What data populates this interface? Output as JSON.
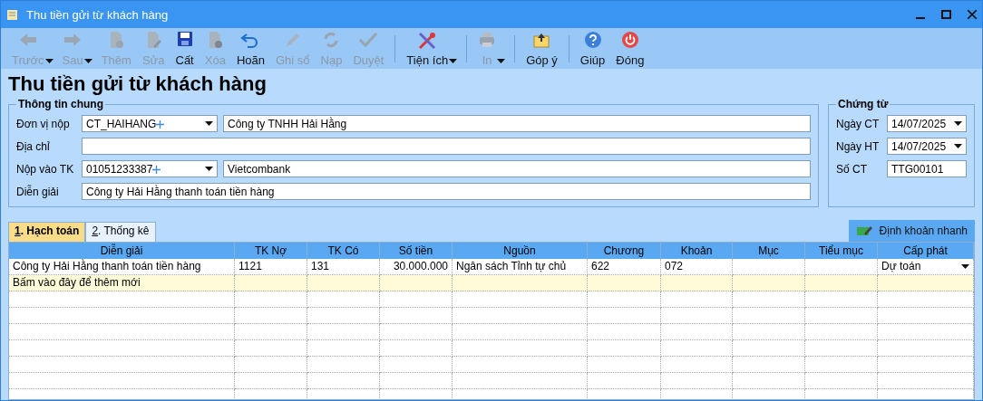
{
  "window": {
    "title": "Thu tiền gửi từ khách hàng"
  },
  "toolbar": [
    {
      "kind": "button",
      "label": "Trước",
      "disabled": true,
      "dropdown": true
    },
    {
      "kind": "button",
      "label": "Sau",
      "disabled": true,
      "dropdown": true
    },
    {
      "kind": "button",
      "label": "Thêm",
      "disabled": true,
      "dropdown": false
    },
    {
      "kind": "button",
      "label": "Sửa",
      "disabled": true,
      "dropdown": false
    },
    {
      "kind": "button",
      "label": "Cất",
      "disabled": false,
      "dropdown": false
    },
    {
      "kind": "button",
      "label": "Xóa",
      "disabled": true,
      "dropdown": false
    },
    {
      "kind": "button",
      "label": "Hoãn",
      "disabled": false,
      "dropdown": false
    },
    {
      "kind": "button",
      "label": "Ghi sổ",
      "disabled": true,
      "dropdown": false
    },
    {
      "kind": "button",
      "label": "Nạp",
      "disabled": true,
      "dropdown": false
    },
    {
      "kind": "button",
      "label": "Duyệt",
      "disabled": true,
      "dropdown": false
    },
    {
      "kind": "separator"
    },
    {
      "kind": "button",
      "label": "Tiện ích",
      "disabled": false,
      "dropdown": true
    },
    {
      "kind": "separator"
    },
    {
      "kind": "button",
      "label": "In",
      "disabled": true,
      "dropdown": true
    },
    {
      "kind": "separator"
    },
    {
      "kind": "button",
      "label": "Góp ý",
      "disabled": false,
      "dropdown": false
    },
    {
      "kind": "separator"
    },
    {
      "kind": "button",
      "label": "Giúp",
      "disabled": false,
      "dropdown": false
    },
    {
      "kind": "button",
      "label": "Đóng",
      "disabled": false,
      "dropdown": false
    }
  ],
  "heading": "Thu tiền gửi từ khách hàng",
  "general": {
    "title": "Thông tin chung",
    "fields": [
      {
        "kind": "lookup",
        "label": "Đơn vị nộp",
        "code": "CT_HAIHANG",
        "value": "Công ty TNHH Hải Hằng"
      },
      {
        "kind": "text",
        "label": "Địa chỉ"
      },
      {
        "kind": "lookup",
        "label": "Nộp vào TK",
        "code": "01051233387",
        "value": "Vietcombank"
      },
      {
        "kind": "text",
        "label": "Diễn giải",
        "value": "Công ty Hải Hằng thanh toán tiền hàng"
      }
    ]
  },
  "voucher": {
    "title": "Chứng từ",
    "fields": [
      {
        "kind": "date",
        "label": "Ngày CT",
        "value": "14/07/2025"
      },
      {
        "kind": "date",
        "label": "Ngày HT",
        "value": "14/07/2025"
      },
      {
        "kind": "text",
        "label": "Số CT",
        "value": "TTG00101"
      }
    ]
  },
  "tabs": [
    {
      "key": "1",
      "label": ". Hạch toán",
      "selected": true
    },
    {
      "key": "2",
      "label": ". Thống kê",
      "selected": false
    }
  ],
  "quick_button": "Định khoản nhanh",
  "table": {
    "columns": [
      "Diễn giải",
      "TK Nợ",
      "TK Có",
      "Số tiền",
      "Nguồn",
      "Chương",
      "Khoản",
      "Mục",
      "Tiểu mục",
      "Cấp phát"
    ],
    "rows": [
      [
        "Công ty Hải Hằng thanh toán tiền hàng",
        "1121",
        "131",
        "30.000.000",
        "Ngân sách Tỉnh tự chủ",
        "622",
        "072",
        "",
        "",
        "Dự toán"
      ]
    ],
    "new_row_hint": "Bấm vào đây để thêm mới"
  }
}
